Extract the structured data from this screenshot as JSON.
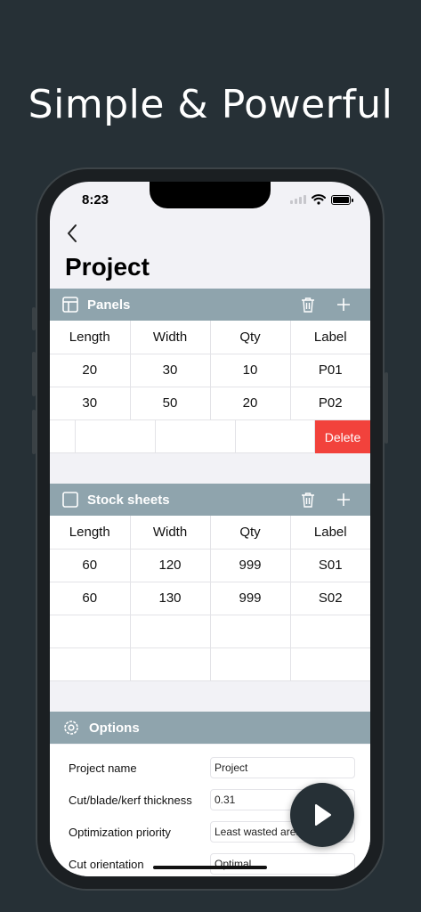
{
  "headline": "Simple & Powerful",
  "status": {
    "time": "8:23"
  },
  "page": {
    "title": "Project"
  },
  "panels": {
    "title": "Panels",
    "columns": [
      "Length",
      "Width",
      "Qty",
      "Label"
    ],
    "rows": [
      [
        "20",
        "30",
        "10",
        "P01"
      ],
      [
        "30",
        "50",
        "20",
        "P02"
      ]
    ],
    "delete_label": "Delete"
  },
  "stock": {
    "title": "Stock sheets",
    "columns": [
      "Length",
      "Width",
      "Qty",
      "Label"
    ],
    "rows": [
      [
        "60",
        "120",
        "999",
        "S01"
      ],
      [
        "60",
        "130",
        "999",
        "S02"
      ]
    ]
  },
  "options": {
    "title": "Options",
    "fields": [
      {
        "label": "Project name",
        "value": "Project"
      },
      {
        "label": "Cut/blade/kerf thickness",
        "value": "0.31"
      },
      {
        "label": "Optimization priority",
        "value": "Least wasted area"
      },
      {
        "label": "Cut orientation",
        "value": "Optimal"
      }
    ]
  },
  "colors": {
    "background": "#263036",
    "section": "#8fa4ad",
    "delete": "#f2423c"
  }
}
